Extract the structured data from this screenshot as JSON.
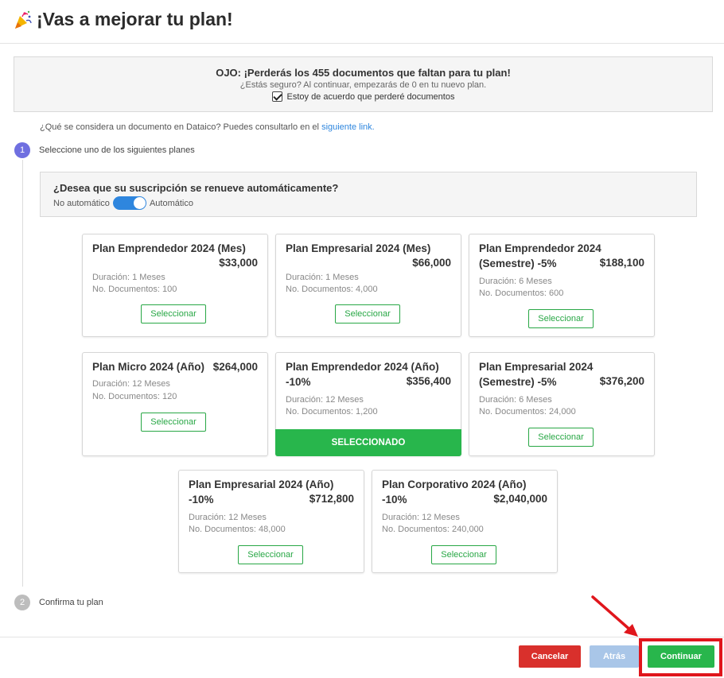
{
  "header": {
    "title": "¡Vas a mejorar tu plan!",
    "icon": "party-popper-icon"
  },
  "warning": {
    "title": "OJO: ¡Perderás los 455 documentos que faltan para tu plan!",
    "subtitle": "¿Estás seguro? Al continuar, empezarás de 0 en tu nuevo plan.",
    "checkbox_label": "Estoy de acuerdo que perderé documentos",
    "checked": true
  },
  "info": {
    "text": "¿Qué se considera un documento en Dataico? Puedes consultarlo en el ",
    "link": "siguiente link."
  },
  "steps": [
    {
      "number": "1",
      "label": "Seleccione uno de los siguientes planes"
    },
    {
      "number": "2",
      "label": "Confirma tu plan"
    }
  ],
  "renew": {
    "question": "¿Desea que su suscripción se renueve automáticamente?",
    "off_label": "No automático",
    "on_label": "Automático",
    "enabled": true
  },
  "plans": [
    {
      "name": "Plan Emprendedor 2024 (Mes)",
      "price": "$33,000",
      "duration": "Duración: 1 Meses",
      "docs": "No. Documentos: 100",
      "button": "Seleccionar"
    },
    {
      "name": "Plan Empresarial 2024 (Mes)",
      "price": "$66,000",
      "duration": "Duración: 1 Meses",
      "docs": "No. Documentos: 4,000",
      "button": "Seleccionar"
    },
    {
      "name_l1": "Plan Emprendedor 2024",
      "name_l2": "(Semestre) -5%",
      "price": "$188,100",
      "duration": "Duración: 6 Meses",
      "docs": "No. Documentos: 600",
      "button": "Seleccionar"
    },
    {
      "name": "Plan Micro 2024 (Año)",
      "price": "$264,000",
      "duration": "Duración: 12 Meses",
      "docs": "No. Documentos: 120",
      "button": "Seleccionar"
    },
    {
      "name_l1": "Plan Emprendedor 2024 (Año)",
      "name_l2": "-10%",
      "price": "$356,400",
      "duration": "Duración: 12 Meses",
      "docs": "No. Documentos: 1,200",
      "button": "SELECCIONADO"
    },
    {
      "name_l1": "Plan Empresarial 2024",
      "name_l2": "(Semestre) -5%",
      "price": "$376,200",
      "duration": "Duración: 6 Meses",
      "docs": "No. Documentos: 24,000",
      "button": "Seleccionar"
    },
    {
      "name_l1": "Plan Empresarial 2024 (Año)",
      "name_l2": "-10%",
      "price": "$712,800",
      "duration": "Duración: 12 Meses",
      "docs": "No. Documentos: 48,000",
      "button": "Seleccionar"
    },
    {
      "name_l1": "Plan Corporativo 2024 (Año)",
      "name_l2": "-10%",
      "price": "$2,040,000",
      "duration": "Duración: 12 Meses",
      "docs": "No. Documentos: 240,000",
      "button": "Seleccionar"
    }
  ],
  "footer": {
    "cancel": "Cancelar",
    "back": "Atrás",
    "continue": "Continuar"
  },
  "colors": {
    "primary_green": "#28b64c",
    "danger_red": "#d9302c",
    "step_active": "#6f6fe0",
    "link_blue": "#2e86de",
    "highlight_red": "#e0161c"
  }
}
